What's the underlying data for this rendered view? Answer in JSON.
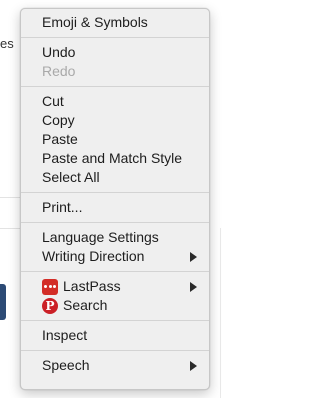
{
  "background": {
    "partial_text": "es"
  },
  "menu": {
    "items": {
      "emoji": "Emoji & Symbols",
      "undo": "Undo",
      "redo": "Redo",
      "cut": "Cut",
      "copy": "Copy",
      "paste": "Paste",
      "paste_match": "Paste and Match Style",
      "select_all": "Select All",
      "print": "Print...",
      "language_settings": "Language Settings",
      "writing_direction": "Writing Direction",
      "lastpass": "LastPass",
      "search": "Search",
      "inspect": "Inspect",
      "speech": "Speech"
    },
    "icons": {
      "lastpass": "lastpass-icon",
      "pinterest": "pinterest-icon",
      "pinterest_glyph": "P"
    },
    "colors": {
      "menu_bg": "#efefef",
      "text": "#1d1d1d",
      "disabled": "#a9a9a9",
      "lastpass_red": "#d32d27",
      "pinterest_red": "#cb2027"
    }
  }
}
